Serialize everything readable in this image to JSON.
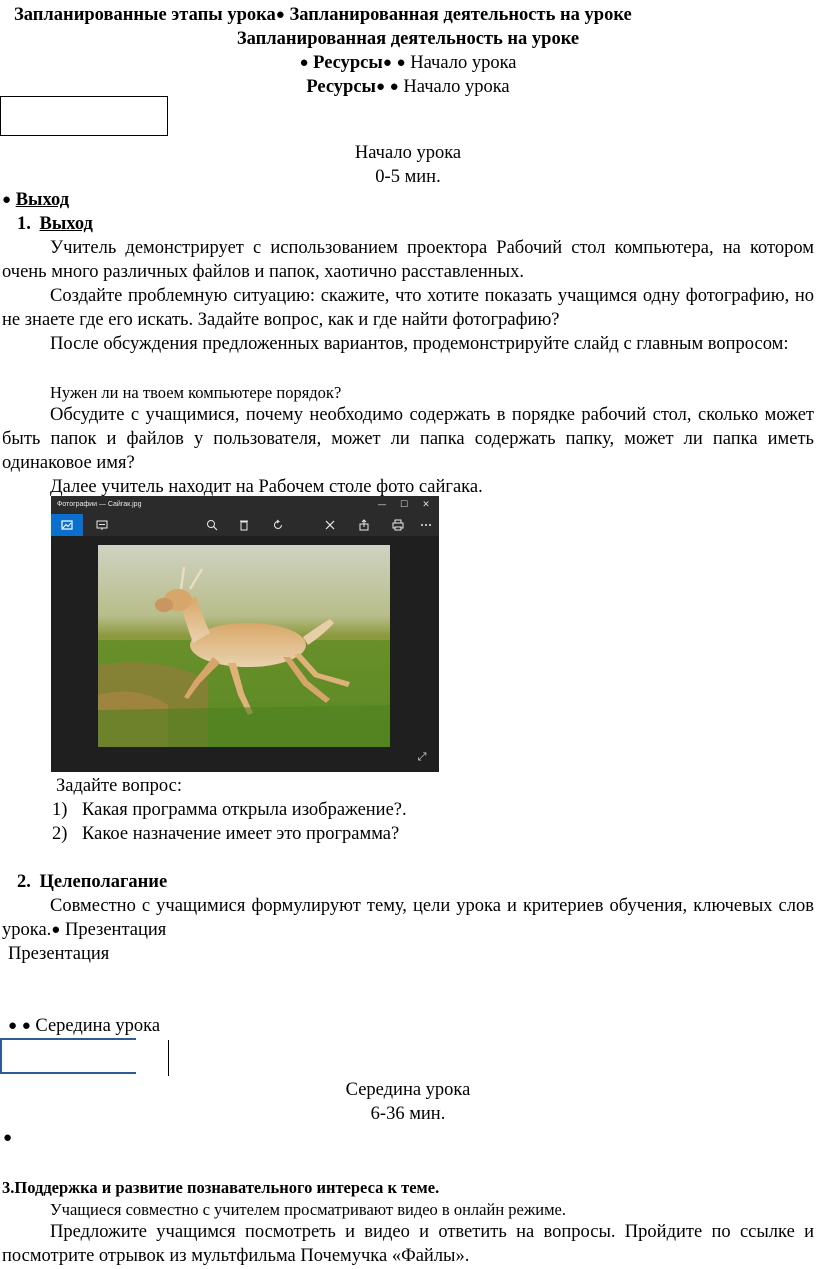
{
  "header": {
    "line1_a": "Запланированные этапы урока",
    "line1_b": "Запланированная деятельность на уроке",
    "line2": "Запланированная деятельность на уроке",
    "line3_bold": "Ресурсы",
    "line3_rest": "Начало урока",
    "line4_bold": "Ресурсы",
    "line4_rest": "Начало урока"
  },
  "stage1": {
    "title": "Начало урока",
    "time": "0-5 мин."
  },
  "section_exit": {
    "bullet_heading": "Выход",
    "number": "1.",
    "heading": "Выход",
    "p1": "Учитель демонстрирует с использованием проектора Рабочий стол компьютера, на котором очень много различных файлов и папок, хаотично расставленных.",
    "p2": "Создайте проблемную ситуацию: скажите, что хотите показать учащимся одну фотографию, но не знаете где его искать. Задайте вопрос, как и где найти фотографию?",
    "p3": "После обсуждения предложенных вариантов, продемонстрируйте слайд с главным вопросом:",
    "question": "Нужен ли на твоем компьютере порядок?",
    "p4": "Обсудите с учащимися, почему необходимо содержать в порядке рабочий стол, сколько может быть папок и файлов у пользователя, может ли папка содержать папку, может ли папка иметь одинаковое имя?",
    "p5": "Далее учитель находит на Рабочем столе фото сайгака."
  },
  "photo_window": {
    "title": "Фотографии — Сайгак.jpg",
    "controls": [
      "—",
      "☐",
      "✕"
    ],
    "toolbar_icons": [
      "image-icon",
      "slideshow-icon",
      "zoom-icon",
      "delete-icon",
      "rotate-icon",
      "edit-icon",
      "share-icon",
      "print-icon",
      "more-icon"
    ]
  },
  "questions": {
    "intro": "Задайте вопрос:",
    "items": [
      {
        "num": "1)",
        "text": "Какая программа открыла изображение?."
      },
      {
        "num": "2)",
        "text": "Какое назначение имеет это программа?"
      }
    ]
  },
  "goal": {
    "number": "2.",
    "heading": "Целеполагание",
    "text": "Совместно с учащимися формулируют тему, цели урока и критериев обучения, ключевых слов урока.",
    "inline_resource": "Презентация",
    "resource": "Презентация"
  },
  "middle": {
    "bullet_label": "Середина урока",
    "title": "Середина урока",
    "time": "6-36 мин."
  },
  "support": {
    "heading": "3.Поддержка и развитие познавательного интереса к теме.",
    "p1": "Учащиеся совместно с учителем просматривают видео в онлайн режиме.",
    "p2": "Предложите учащимся  посмотреть и видео и ответить на вопросы. Пройдите по ссылке и посмотрите отрывок из мультфильма Почемучка «Файлы»."
  }
}
